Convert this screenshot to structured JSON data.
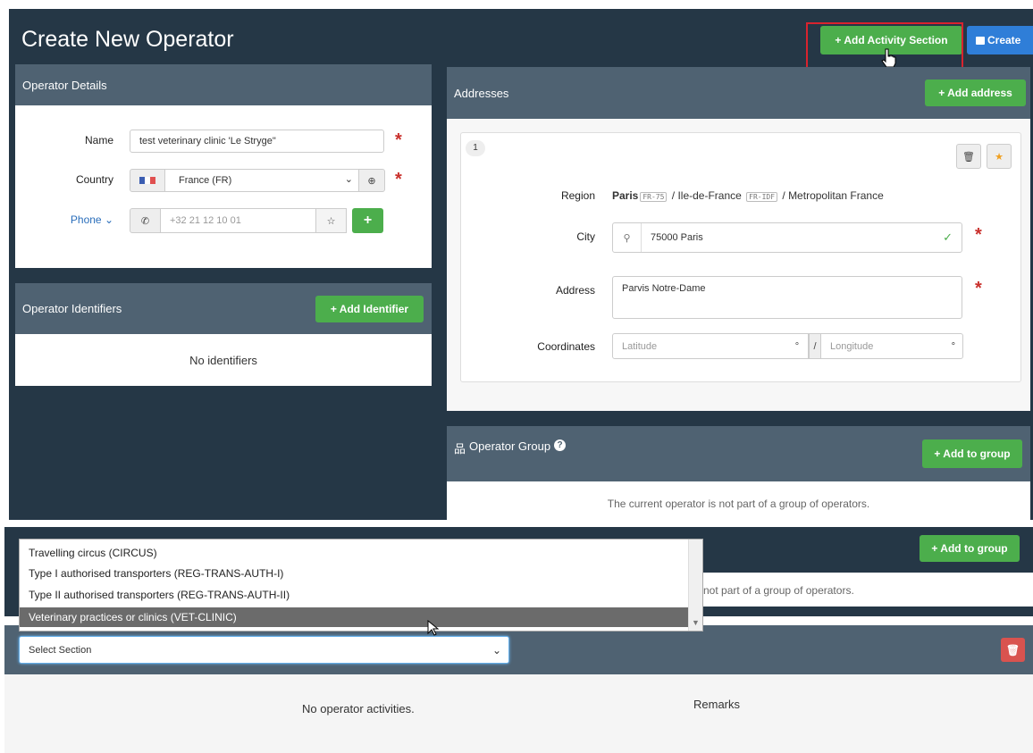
{
  "page_title": "Create New Operator",
  "header_buttons": {
    "add_activity_section": "+ Add Activity Section",
    "create": "Create"
  },
  "operator_details": {
    "title": "Operator Details",
    "name_label": "Name",
    "name_value": "test veterinary clinic 'Le Stryge\"",
    "country_label": "Country",
    "country_value": "France (FR)",
    "phone_label": "Phone",
    "phone_placeholder": "+32 21 12 10 01"
  },
  "operator_identifiers": {
    "title": "Operator Identifiers",
    "add_button": "+ Add Identifier",
    "empty_text": "No identifiers"
  },
  "addresses": {
    "title": "Addresses",
    "add_button": "+ Add address",
    "card": {
      "index": "1",
      "region_label": "Region",
      "region_city": "Paris",
      "region_city_code": "FR-75",
      "region_sep1": " / Ile-de-France ",
      "region_region_code": "FR-IDF",
      "region_tail": " / Metropolitan France",
      "city_label": "City",
      "city_value": "75000 Paris",
      "address_label": "Address",
      "address_value": "Parvis Notre-Dame",
      "coordinates_label": "Coordinates",
      "latitude_placeholder": "Latitude",
      "longitude_placeholder": "Longitude",
      "degree": "°",
      "slash": "/"
    }
  },
  "operator_group": {
    "title": "Operator Group",
    "add_button": "+ Add to group",
    "empty_text": "The current operator is not part of a group of operators."
  },
  "bottom": {
    "add_to_group_button": "+ Add to group",
    "group_text_partial": "is not part of a group of operators.",
    "dropdown_options": [
      "Travelling circus (CIRCUS)",
      "Type I authorised transporters (REG-TRANS-AUTH-I)",
      "Type II authorised transporters (REG-TRANS-AUTH-II)",
      "Veterinary practices or clinics (VET-CLINIC)"
    ],
    "select_value": "Select Section",
    "no_activities": "No operator activities.",
    "remarks": "Remarks"
  },
  "colors": {
    "dark_bg": "#253746",
    "panel_header": "#4f6272",
    "green": "#4cae4c",
    "blue": "#2f7ed8",
    "red": "#d9534f",
    "highlight_box": "#d9232e"
  },
  "icons": [
    "flag-fr-icon",
    "globe-icon",
    "phone-icon",
    "star-icon",
    "plus-icon",
    "trash-icon",
    "search-icon",
    "check-icon",
    "network-icon",
    "question-icon",
    "cursor-hand-icon",
    "cursor-arrow-icon",
    "chevron-down-icon"
  ]
}
